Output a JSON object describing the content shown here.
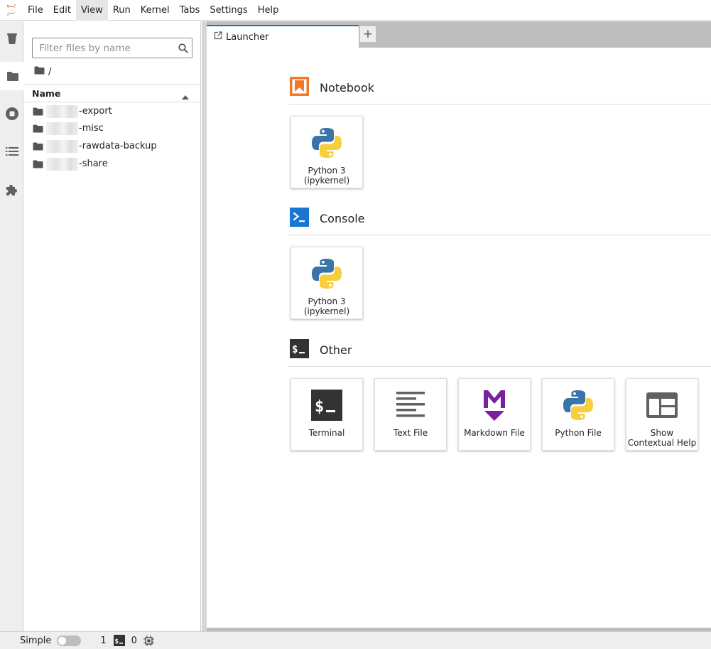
{
  "menu": {
    "items": [
      {
        "label": "File"
      },
      {
        "label": "Edit"
      },
      {
        "label": "View"
      },
      {
        "label": "Run"
      },
      {
        "label": "Kernel"
      },
      {
        "label": "Tabs"
      },
      {
        "label": "Settings"
      },
      {
        "label": "Help"
      }
    ],
    "active_index": 2
  },
  "activity_bar": {
    "icons": [
      "trash-icon",
      "folder-icon",
      "stop-circle-icon",
      "list-icon",
      "puzzle-icon"
    ],
    "active": "folder-icon"
  },
  "file_browser": {
    "filter_placeholder": "Filter files by name",
    "breadcrumb": "/",
    "column_name": "Name",
    "items": [
      {
        "name": "-export"
      },
      {
        "name": "-misc"
      },
      {
        "name": "-rawdata-backup"
      },
      {
        "name": "-share"
      }
    ]
  },
  "tabs": [
    {
      "label": "Launcher"
    }
  ],
  "new_tab_label": "+",
  "launcher": {
    "sections": [
      {
        "title": "Notebook",
        "items": [
          {
            "label": "Python 3\n(ipykernel)"
          }
        ]
      },
      {
        "title": "Console",
        "items": [
          {
            "label": "Python 3\n(ipykernel)"
          }
        ]
      },
      {
        "title": "Other",
        "items": [
          {
            "label": "Terminal"
          },
          {
            "label": "Text File"
          },
          {
            "label": "Markdown File"
          },
          {
            "label": "Python File"
          },
          {
            "label": "Show\nContextual Help"
          }
        ]
      }
    ]
  },
  "status_bar": {
    "mode_label": "Simple",
    "kernels_count": "1",
    "terminals_count": "0"
  },
  "colors": {
    "accent": "#1976d2",
    "notebook_orange": "#f37726",
    "console_blue": "#1976d2",
    "markdown_purple": "#7b1fa2",
    "python_blue": "#3a74a8",
    "python_yellow": "#f7cf3c"
  }
}
